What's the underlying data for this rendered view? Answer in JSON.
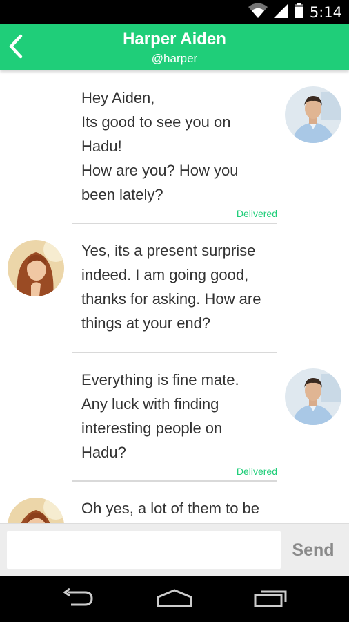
{
  "status_bar": {
    "time": "5:14"
  },
  "header": {
    "title": "Harper Aiden",
    "handle": "@harper"
  },
  "messages": [
    {
      "sender": "me",
      "lines": [
        "Hey Aiden,",
        "Its good to see you on",
        "Hadu!",
        "How are you? How you",
        "been lately?"
      ],
      "status": "Delivered"
    },
    {
      "sender": "harper",
      "lines": [
        "Yes, its a present surprise",
        "indeed. I am going good,",
        "thanks for asking. How are",
        "things at your end?"
      ]
    },
    {
      "sender": "me",
      "lines": [
        "Everything is fine mate.",
        "Any luck with finding",
        "interesting people on",
        "Hadu?"
      ],
      "status": "Delivered"
    },
    {
      "sender": "harper",
      "lines": [
        "Oh yes, a lot of them to be"
      ]
    }
  ],
  "composer": {
    "placeholder": "",
    "send_label": "Send"
  },
  "icons": {
    "back": "back-arrow-icon",
    "wifi": "wifi-icon",
    "signal": "signal-icon",
    "battery": "battery-icon",
    "nav_back": "nav-back-icon",
    "nav_home": "nav-home-icon",
    "nav_recents": "nav-recents-icon"
  },
  "colors": {
    "accent": "#1fce79",
    "status_bar": "#000000",
    "composer_bg": "#ededed",
    "text": "#333333"
  }
}
